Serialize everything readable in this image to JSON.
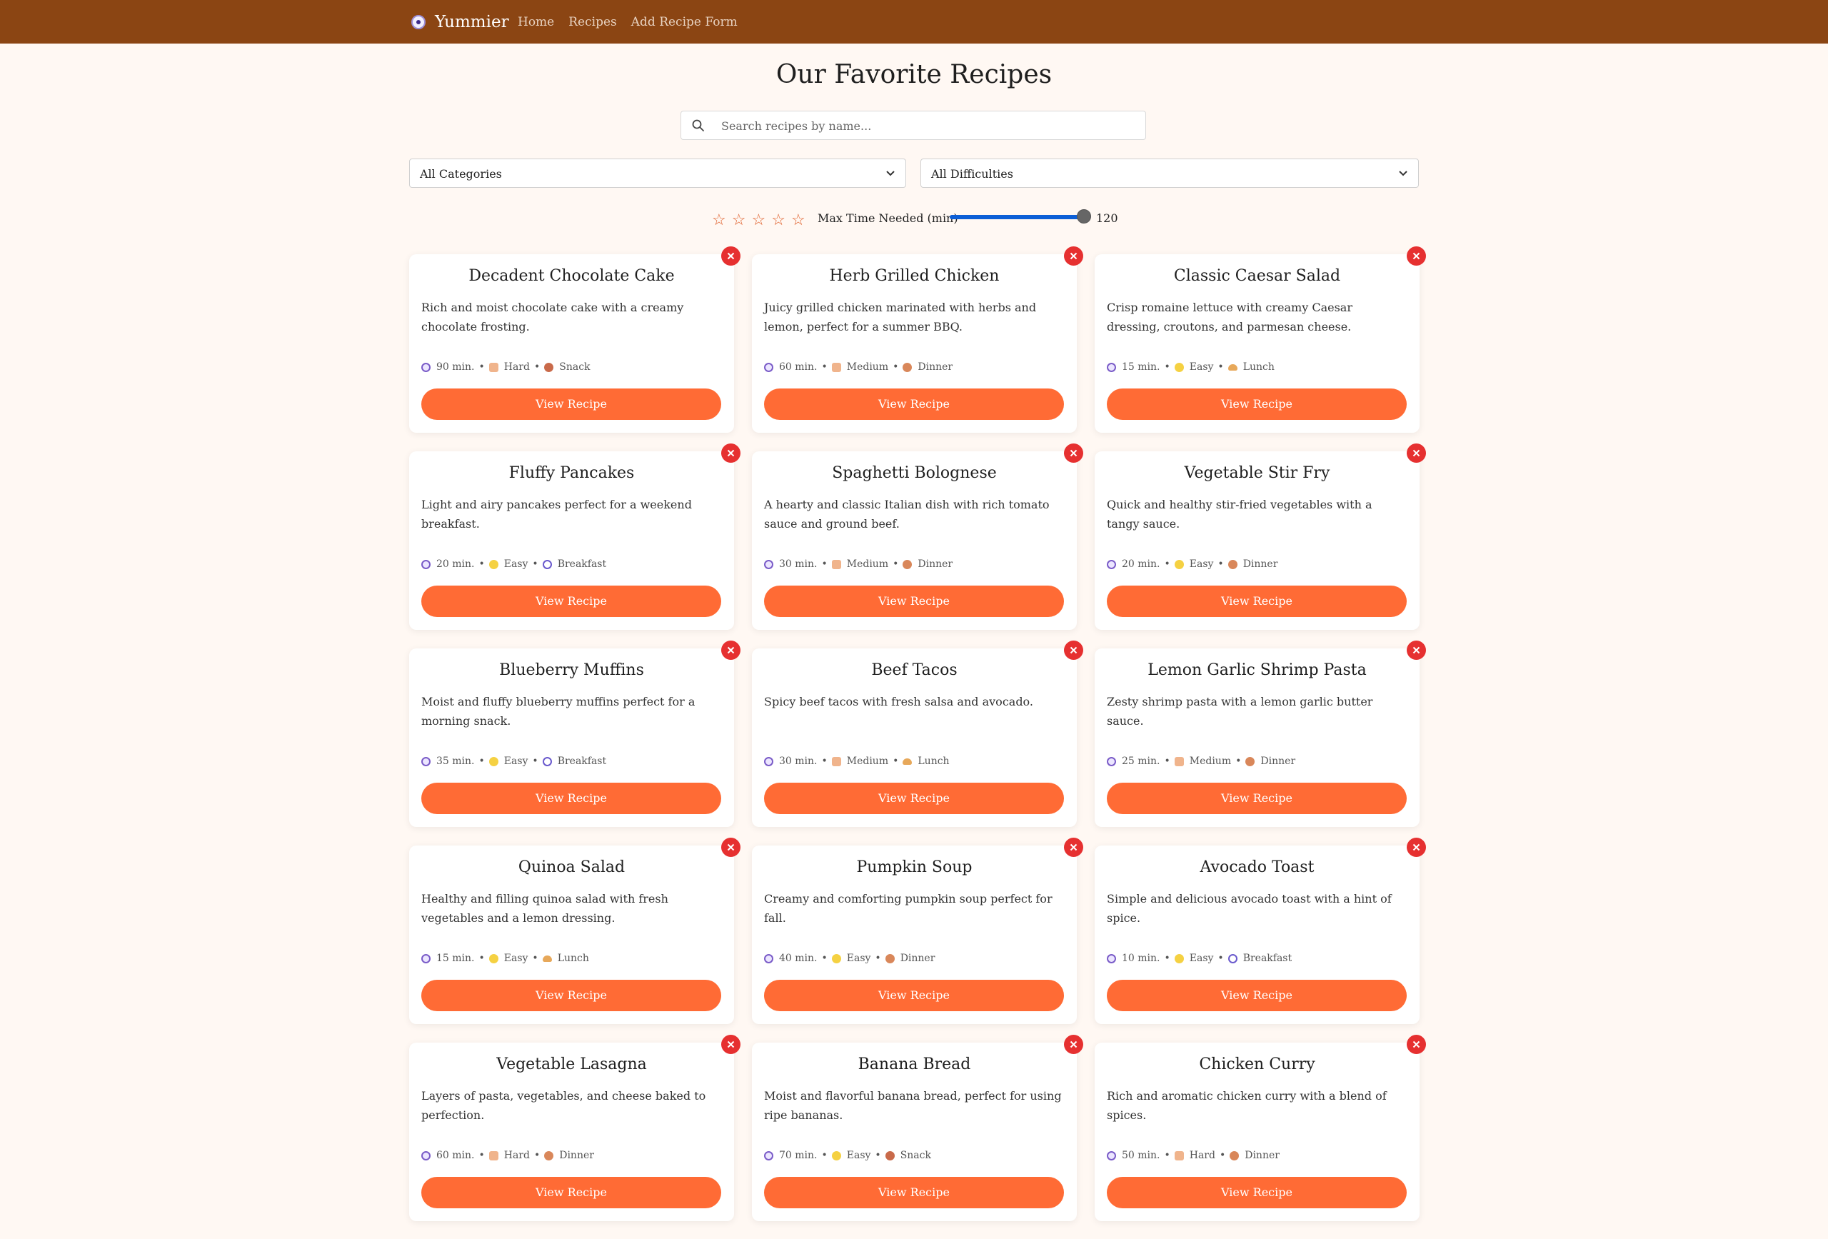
{
  "nav": {
    "brand": "Yummier",
    "links": [
      "Home",
      "Recipes",
      "Add Recipe Form"
    ]
  },
  "page": {
    "title": "Our Favorite Recipes",
    "search_placeholder": "Search recipes by name..."
  },
  "filters": {
    "category": "All Categories",
    "difficulty": "All Difficulties",
    "rating_stars": 5,
    "rating_selected": 0,
    "time_label": "Max Time Needed (min)",
    "time_value": "120",
    "time_max": 120
  },
  "labels": {
    "view_button": "View Recipe"
  },
  "recipes": [
    {
      "title": "Decadent Chocolate Cake",
      "description": "Rich and moist chocolate cake with a creamy chocolate frosting.",
      "time": "90 min.",
      "difficulty": "Hard",
      "category": "Snack"
    },
    {
      "title": "Herb Grilled Chicken",
      "description": "Juicy grilled chicken marinated with herbs and lemon, perfect for a summer BBQ.",
      "time": "60 min.",
      "difficulty": "Medium",
      "category": "Dinner"
    },
    {
      "title": "Classic Caesar Salad",
      "description": "Crisp romaine lettuce with creamy Caesar dressing, croutons, and parmesan cheese.",
      "time": "15 min.",
      "difficulty": "Easy",
      "category": "Lunch"
    },
    {
      "title": "Fluffy Pancakes",
      "description": "Light and airy pancakes perfect for a weekend breakfast.",
      "time": "20 min.",
      "difficulty": "Easy",
      "category": "Breakfast"
    },
    {
      "title": "Spaghetti Bolognese",
      "description": "A hearty and classic Italian dish with rich tomato sauce and ground beef.",
      "time": "30 min.",
      "difficulty": "Medium",
      "category": "Dinner"
    },
    {
      "title": "Vegetable Stir Fry",
      "description": "Quick and healthy stir-fried vegetables with a tangy sauce.",
      "time": "20 min.",
      "difficulty": "Easy",
      "category": "Dinner"
    },
    {
      "title": "Blueberry Muffins",
      "description": "Moist and fluffy blueberry muffins perfect for a morning snack.",
      "time": "35 min.",
      "difficulty": "Easy",
      "category": "Breakfast"
    },
    {
      "title": "Beef Tacos",
      "description": "Spicy beef tacos with fresh salsa and avocado.",
      "time": "30 min.",
      "difficulty": "Medium",
      "category": "Lunch"
    },
    {
      "title": "Lemon Garlic Shrimp Pasta",
      "description": "Zesty shrimp pasta with a lemon garlic butter sauce.",
      "time": "25 min.",
      "difficulty": "Medium",
      "category": "Dinner"
    },
    {
      "title": "Quinoa Salad",
      "description": "Healthy and filling quinoa salad with fresh vegetables and a lemon dressing.",
      "time": "15 min.",
      "difficulty": "Easy",
      "category": "Lunch"
    },
    {
      "title": "Pumpkin Soup",
      "description": "Creamy and comforting pumpkin soup perfect for fall.",
      "time": "40 min.",
      "difficulty": "Easy",
      "category": "Dinner"
    },
    {
      "title": "Avocado Toast",
      "description": "Simple and delicious avocado toast with a hint of spice.",
      "time": "10 min.",
      "difficulty": "Easy",
      "category": "Breakfast"
    },
    {
      "title": "Vegetable Lasagna",
      "description": "Layers of pasta, vegetables, and cheese baked to perfection.",
      "time": "60 min.",
      "difficulty": "Hard",
      "category": "Dinner"
    },
    {
      "title": "Banana Bread",
      "description": "Moist and flavorful banana bread, perfect for using ripe bananas.",
      "time": "70 min.",
      "difficulty": "Easy",
      "category": "Snack"
    },
    {
      "title": "Chicken Curry",
      "description": "Rich and aromatic chicken curry with a blend of spices.",
      "time": "50 min.",
      "difficulty": "Hard",
      "category": "Dinner"
    }
  ],
  "colors": {
    "navbar": "#8b4513",
    "background": "#fff8f3",
    "accent": "#ff6b35",
    "delete": "#e63030",
    "slider": "#0d5fd6"
  }
}
